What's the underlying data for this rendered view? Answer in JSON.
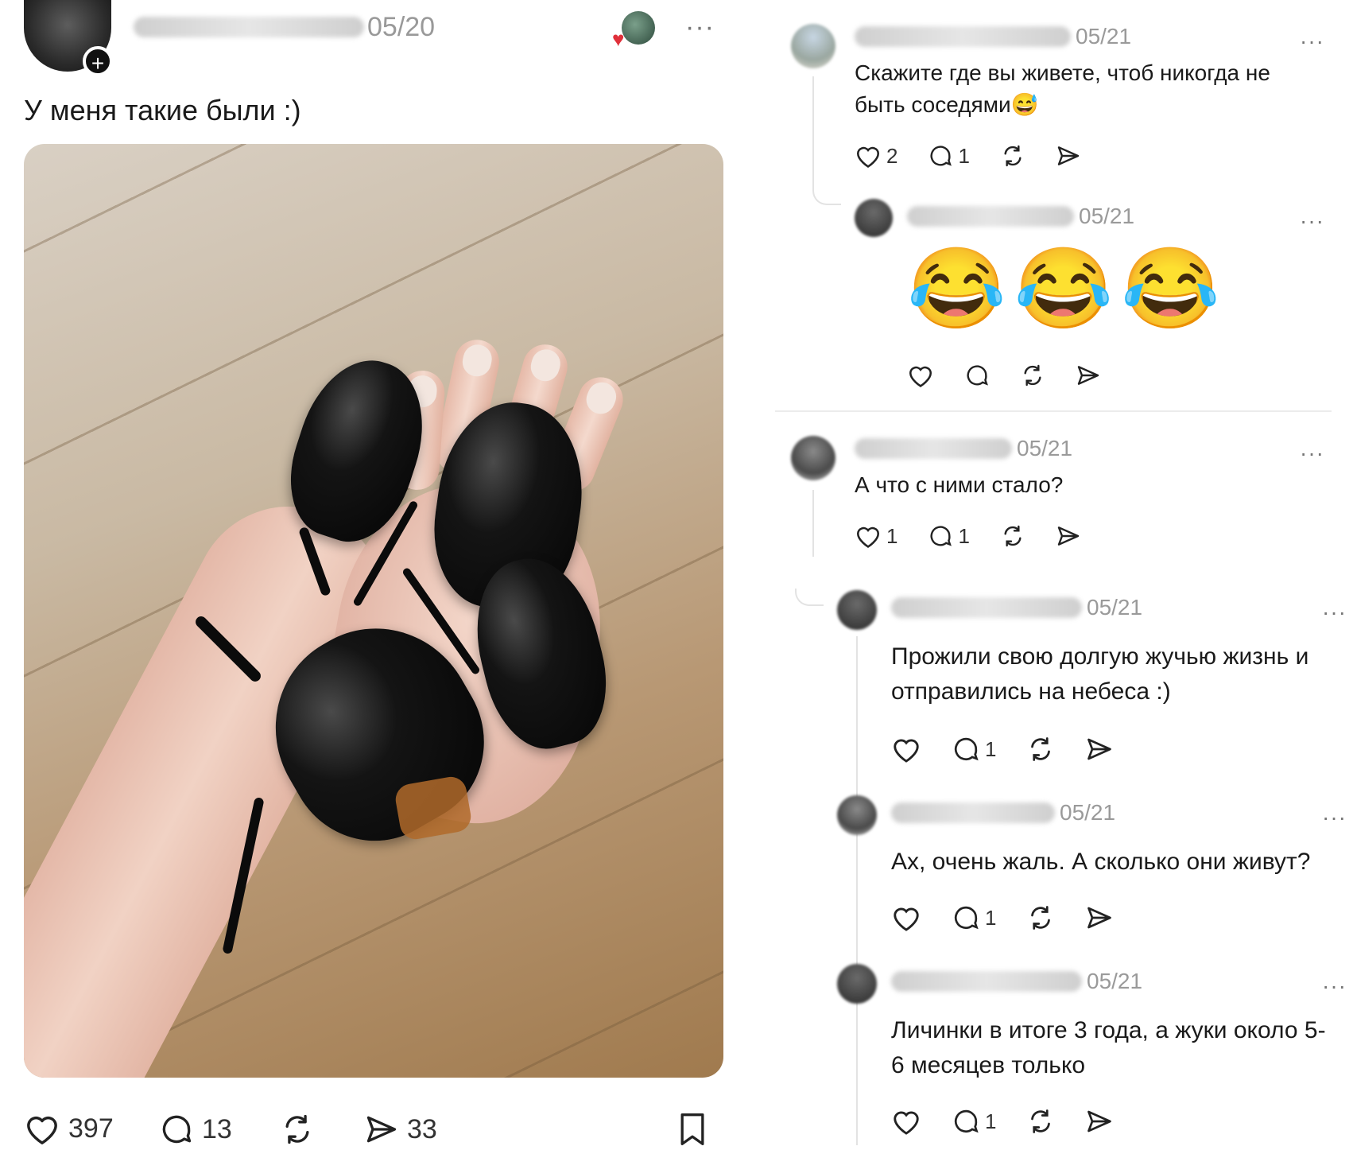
{
  "post": {
    "date": "05/20",
    "text": "У меня такие были :)",
    "more": "···",
    "plus": "+",
    "likes": "397",
    "comments": "13",
    "shares": "33",
    "image_alt": "beetles-on-hand-photo"
  },
  "comments": [
    {
      "date": "05/21",
      "text": "Скажите где вы живете, чтоб никогда не быть соседями😅",
      "likes": "2",
      "replies": "1"
    },
    {
      "date": "05/21",
      "text": "😂😂😂",
      "likes": "",
      "replies": ""
    },
    {
      "date": "05/21",
      "text": "А что с ними стало?",
      "likes": "1",
      "replies": "1"
    },
    {
      "date": "05/21",
      "text": "Прожили свою долгую жучью жизнь и отправились на небеса :)",
      "likes": "",
      "replies": "1"
    },
    {
      "date": "05/21",
      "text": "Ах, очень жаль. А сколько они живут?",
      "likes": "",
      "replies": "1"
    },
    {
      "date": "05/21",
      "text": "Личинки в итоге 3 года, а жуки около 5-6 месяцев только",
      "likes": "",
      "replies": "1"
    }
  ],
  "colors": {
    "heart_badge": "#e0303a",
    "muted_text": "#9a9a9a",
    "thread_line": "#e3e3e3"
  },
  "icons": [
    "heart-icon",
    "comment-icon",
    "repost-icon",
    "send-icon",
    "bookmark-icon",
    "more-icon",
    "plus-icon"
  ]
}
